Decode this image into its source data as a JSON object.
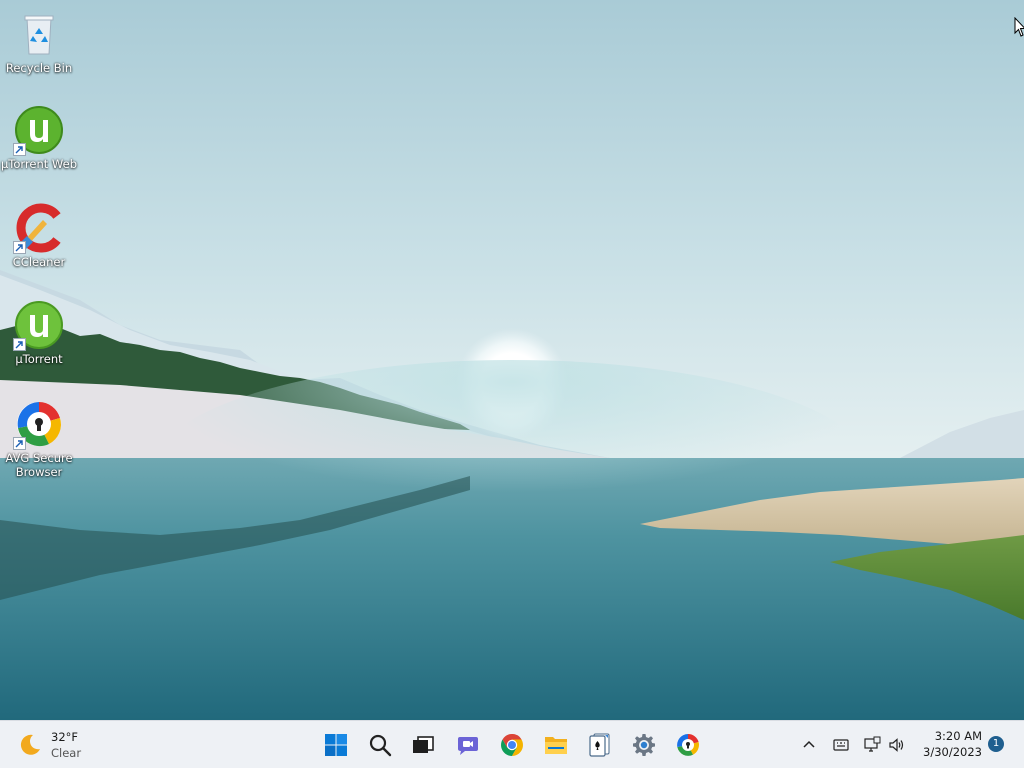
{
  "desktop": {
    "icons": [
      {
        "label": "Recycle Bin",
        "icon": "recycle-bin-icon",
        "shortcut": false
      },
      {
        "label": "µTorrent Web",
        "icon": "utorrent-web-icon",
        "shortcut": true
      },
      {
        "label": "CCleaner",
        "icon": "ccleaner-icon",
        "shortcut": true
      },
      {
        "label": "µTorrent",
        "icon": "utorrent-icon",
        "shortcut": true
      },
      {
        "label": "AVG Secure Browser",
        "label_line1": "AVG Secure",
        "label_line2": "Browser",
        "icon": "avg-secure-browser-icon",
        "shortcut": true
      }
    ]
  },
  "taskbar": {
    "weather": {
      "temperature": "32°F",
      "condition": "Clear",
      "icon": "moon-icon"
    },
    "pinned": [
      {
        "name": "Start",
        "icon": "windows-start-icon"
      },
      {
        "name": "Search",
        "icon": "search-icon"
      },
      {
        "name": "Task View",
        "icon": "task-view-icon"
      },
      {
        "name": "Chat",
        "icon": "chat-icon"
      },
      {
        "name": "Google Chrome",
        "icon": "chrome-icon"
      },
      {
        "name": "File Explorer",
        "icon": "file-explorer-icon"
      },
      {
        "name": "Solitaire",
        "icon": "solitaire-icon"
      },
      {
        "name": "Settings",
        "icon": "settings-gear-icon"
      },
      {
        "name": "AVG Secure Browser",
        "icon": "avg-browser-icon"
      }
    ],
    "tray": {
      "icons": [
        "chevron-up-icon",
        "touch-keyboard-icon",
        "network-icon",
        "volume-icon"
      ],
      "time": "3:20 AM",
      "date": "3/30/2023",
      "notification_count": "1"
    }
  },
  "colors": {
    "taskbar_bg": "#eef1f5",
    "accent": "#0078d4",
    "notification_badge": "#1f5f8f"
  }
}
